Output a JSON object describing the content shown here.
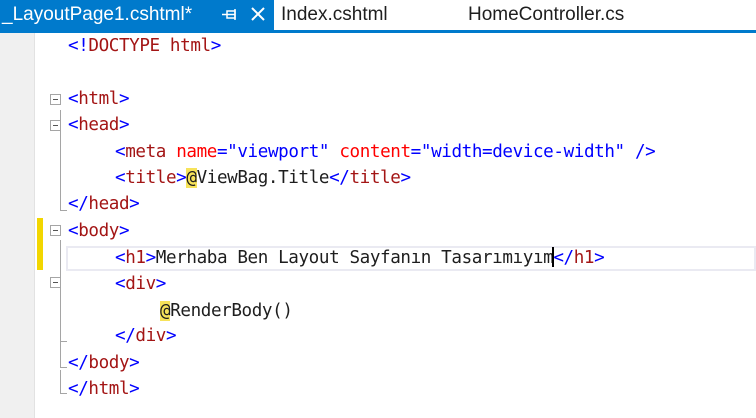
{
  "tabs": [
    {
      "label": "_LayoutPage1.cshtml*",
      "active": true
    },
    {
      "label": "Index.cshtml",
      "active": false
    },
    {
      "label": "HomeController.cs",
      "active": false
    }
  ],
  "tab_icons": {
    "pin": "pin-icon",
    "close": "close-icon"
  },
  "colors": {
    "accent": "#007acc",
    "tag": "#a31515",
    "bracket": "#0000ff",
    "attribute": "#ff0000",
    "razor_highlight": "#f7e35a"
  },
  "code": {
    "doctype": {
      "open": "<!",
      "name": "DOCTYPE html",
      "close": ">"
    },
    "html_open": {
      "open": "<",
      "name": "html",
      "close": ">"
    },
    "head_open": {
      "open": "<",
      "name": "head",
      "close": ">"
    },
    "meta": {
      "open": "<",
      "name": "meta",
      "attr1": "name",
      "eq": "=",
      "val1": "\"viewport\"",
      "attr2": "content",
      "val2": "\"width=device-width\"",
      "close": "/>"
    },
    "title": {
      "open": "<",
      "name": "title",
      "close": ">",
      "at": "@",
      "expr": "ViewBag.Title",
      "end_open": "</",
      "end_close": ">"
    },
    "head_close": {
      "open": "</",
      "name": "head",
      "close": ">"
    },
    "body_open": {
      "open": "<",
      "name": "body",
      "close": ">"
    },
    "h1": {
      "open": "<",
      "name": "h1",
      "close": ">",
      "text": "Merhaba Ben Layout Sayfanın Tasarımıyım",
      "end_open": "</",
      "end_close": ">"
    },
    "div_open": {
      "open": "<",
      "name": "div",
      "close": ">"
    },
    "render": {
      "at": "@",
      "expr": "RenderBody()"
    },
    "div_close": {
      "open": "</",
      "name": "div",
      "close": ">"
    },
    "body_close": {
      "open": "</",
      "name": "body",
      "close": ">"
    },
    "html_close": {
      "open": "</",
      "name": "html",
      "close": ">"
    }
  }
}
